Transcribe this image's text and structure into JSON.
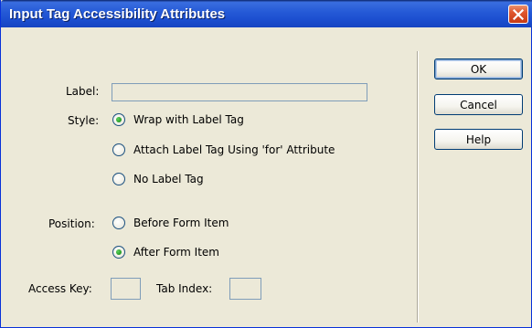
{
  "window": {
    "title": "Input Tag Accessibility Attributes"
  },
  "form": {
    "label_caption": "Label:",
    "label_value": "",
    "style_caption": "Style:",
    "style_options": [
      {
        "label": "Wrap with Label Tag",
        "checked": true
      },
      {
        "label": "Attach Label Tag Using 'for' Attribute",
        "checked": false
      },
      {
        "label": "No Label Tag",
        "checked": false
      }
    ],
    "position_caption": "Position:",
    "position_options": [
      {
        "label": "Before Form Item",
        "checked": false
      },
      {
        "label": "After Form Item",
        "checked": true
      }
    ],
    "access_key_caption": "Access Key:",
    "access_key_value": "",
    "tab_index_caption": "Tab Index:",
    "tab_index_value": ""
  },
  "buttons": {
    "ok": "OK",
    "cancel": "Cancel",
    "help": "Help"
  },
  "icons": {
    "close": "close-icon"
  }
}
